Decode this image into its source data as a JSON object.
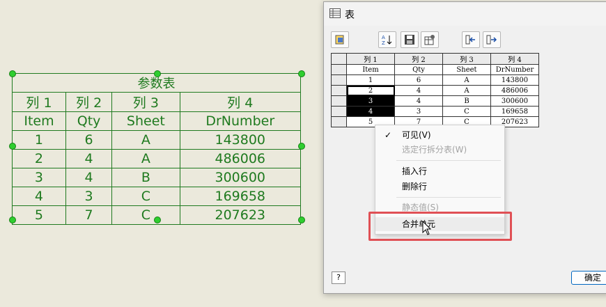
{
  "drawing_table": {
    "title": "参数表",
    "columns": [
      "列 1",
      "列 2",
      "列 3",
      "列 4"
    ],
    "header": [
      "Item",
      "Qty",
      "Sheet",
      "DrNumber"
    ],
    "rows": [
      [
        "1",
        "6",
        "A",
        "143800"
      ],
      [
        "2",
        "4",
        "A",
        "486006"
      ],
      [
        "3",
        "4",
        "B",
        "300600"
      ],
      [
        "4",
        "3",
        "C",
        "169658"
      ],
      [
        "5",
        "7",
        "C",
        "207623"
      ]
    ]
  },
  "dialog": {
    "title": "表",
    "grid": {
      "columns": [
        "列 1",
        "列 2",
        "列 3",
        "列 4"
      ],
      "header": [
        "Item",
        "Qty",
        "Sheet",
        "DrNumber"
      ],
      "rows": [
        [
          "1",
          "6",
          "A",
          "143800"
        ],
        [
          "2",
          "4",
          "A",
          "486006"
        ],
        [
          "3",
          "4",
          "B",
          "300600"
        ],
        [
          "4",
          "3",
          "C",
          "169658"
        ],
        [
          "5",
          "7",
          "C",
          "207623"
        ]
      ]
    },
    "help_label": "?",
    "ok_label": "确定"
  },
  "context_menu": {
    "items": [
      {
        "label": "可见(V)",
        "checked": true,
        "enabled": true
      },
      {
        "label": "选定行拆分表(W)",
        "enabled": false
      },
      {
        "label": "插入行",
        "enabled": true
      },
      {
        "label": "删除行",
        "enabled": true
      },
      {
        "label": "静态值(S)",
        "enabled": false
      },
      {
        "label": "合并单元",
        "enabled": true,
        "highlighted": true
      }
    ]
  },
  "colors": {
    "drawing": "#1f7a1f",
    "highlight": "#e05055",
    "accent": "#0067c0"
  }
}
